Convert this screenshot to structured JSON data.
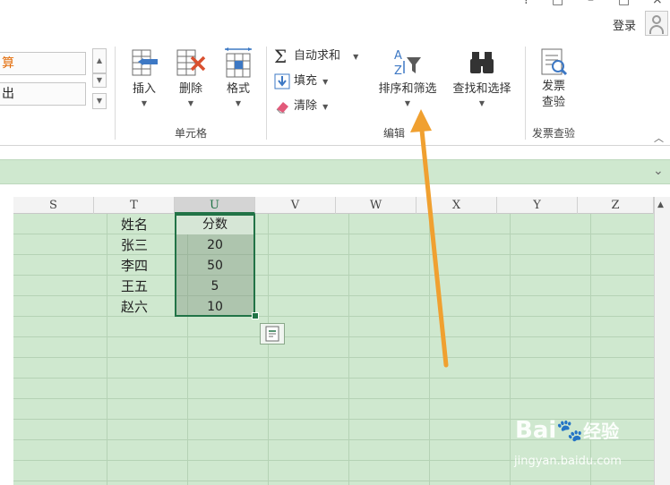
{
  "window": {
    "help_glyph": "?",
    "restore_glyph": "□",
    "minimize_glyph": "–",
    "close_glyph": "×",
    "login_label": "登录"
  },
  "ribbon": {
    "style_cells": [
      "算",
      "出"
    ],
    "cells_group": {
      "label": "单元格",
      "insert": "插入",
      "delete": "删除",
      "format": "格式"
    },
    "edit_group": {
      "label": "编辑",
      "autosum": "自动求和",
      "fill": "填充",
      "clear": "清除",
      "sort_filter": "排序和筛选",
      "find_select": "查找和选择"
    },
    "invoice_group": {
      "label": "发票查验",
      "button": "发票查验"
    }
  },
  "sheet": {
    "columns": [
      "S",
      "T",
      "U",
      "V",
      "W",
      "X",
      "Y",
      "Z"
    ],
    "selected_column": "U",
    "header_row": {
      "name": "姓名",
      "score": "分数"
    },
    "rows": [
      {
        "name": "张三",
        "score": "20"
      },
      {
        "name": "李四",
        "score": "50"
      },
      {
        "name": "王五",
        "score": "5"
      },
      {
        "name": "赵六",
        "score": "10"
      }
    ]
  },
  "annotation": {
    "arrow_color": "#f0a030"
  },
  "watermark": {
    "brand": "Baièå经验",
    "brand_left": "Bai",
    "brand_right": "经验",
    "url": "jingyan.baidu.com"
  },
  "colors": {
    "sheet_bg": "#cfe8cf",
    "accent": "#217346"
  }
}
